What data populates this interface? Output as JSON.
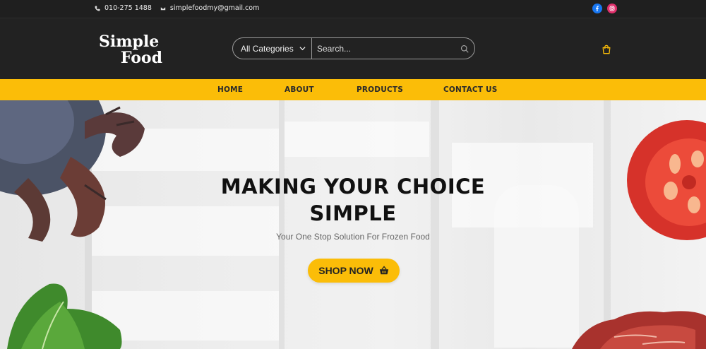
{
  "topbar": {
    "phone": "010-275 1488",
    "email": "simplefoodmy@gmail.com",
    "social": [
      "facebook-icon",
      "instagram-icon"
    ]
  },
  "header": {
    "logo_line1": "Simple",
    "logo_line2": "Food",
    "category_select": "All Categories",
    "search_placeholder": "Search...",
    "cart_icon": "shopping-bag-icon"
  },
  "nav": {
    "items": [
      "HOME",
      "ABOUT",
      "PRODUCTS",
      "CONTACT US"
    ]
  },
  "hero": {
    "headline_line1": "MAKING YOUR CHOICE",
    "headline_line2": "SIMPLE",
    "subheadline": "Your One Stop Solution For Frozen Food",
    "cta_label": "SHOP NOW"
  },
  "colors": {
    "accent": "#fbbd08",
    "header_bg": "#222222",
    "facebook": "#1877f2",
    "instagram": "#e1306c"
  }
}
